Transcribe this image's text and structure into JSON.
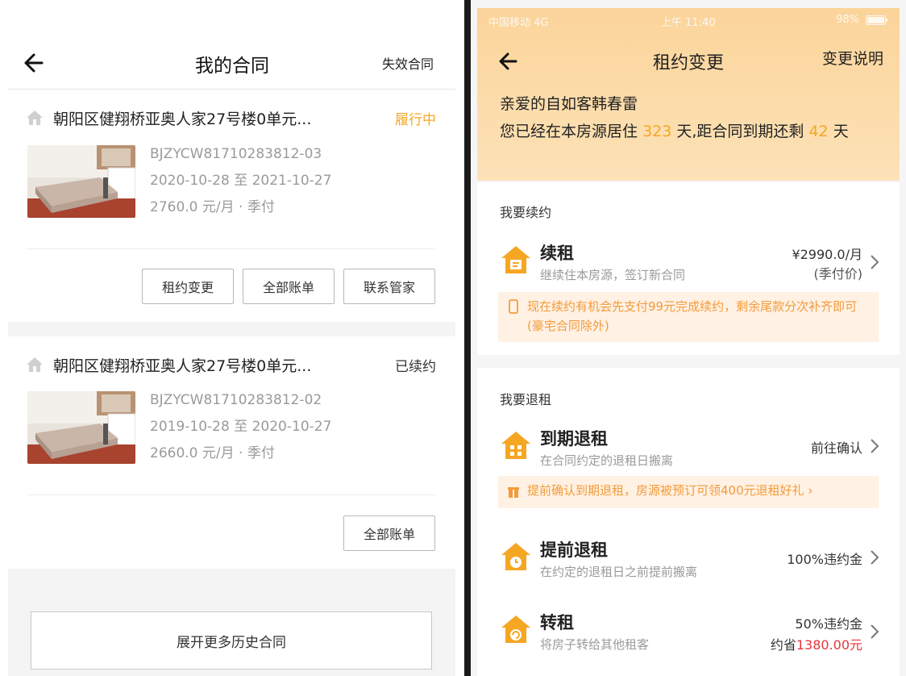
{
  "left": {
    "header": {
      "title": "我的合同",
      "right_link": "失效合同"
    },
    "contracts": [
      {
        "address": "朝阳区健翔桥亚奥人家27号楼0单元...",
        "status": "履行中",
        "status_color": "#f5a623",
        "code": "BJZYCW81710283812-03",
        "period": "2020-10-28 至 2021-10-27",
        "price": "2760.0 元/月 · 季付",
        "buttons": [
          "租约变更",
          "全部账单",
          "联系管家"
        ]
      },
      {
        "address": "朝阳区健翔桥亚奥人家27号楼0单元...",
        "status": "已续约",
        "status_color": "#333333",
        "code": "BJZYCW81710283812-02",
        "period": "2019-10-28 至 2020-10-27",
        "price": "2660.0 元/月 · 季付",
        "buttons": [
          "全部账单"
        ]
      }
    ],
    "expand_label": "展开更多历史合同"
  },
  "right": {
    "status_bar": {
      "carrier": "中国移动 4G",
      "time": "上午 11:40",
      "battery": "98%"
    },
    "header": {
      "title": "租约变更",
      "right_link": "变更说明"
    },
    "greeting": "亲爱的自如客韩春雷",
    "stay": {
      "prefix": "您已经在本房源居住",
      "days_lived": "323",
      "middle": "天,距合同到期还剩",
      "days_left": "42",
      "suffix": "天"
    },
    "renew_section": {
      "label": "我要续约",
      "option": {
        "title": "续租",
        "subtitle": "继续住本房源，签订新合同",
        "price": "¥2990.0/月",
        "price_note": "(季付价)"
      },
      "notice": "现在续约有机会先支付99元完成续约，剩余尾款分次补齐即可(豪宅合同除外)"
    },
    "terminate_section": {
      "label": "我要退租",
      "options": [
        {
          "title": "到期退租",
          "subtitle": "在合同约定的退租日搬离",
          "right": "前往确认"
        },
        {
          "title": "提前退租",
          "subtitle": "在约定的退租日之前提前搬离",
          "right": "100%违约金"
        },
        {
          "title": "转租",
          "subtitle": "将房子转给其他租客",
          "right": "50%违约金",
          "saving_prefix": "约省",
          "saving": "1380.00元"
        }
      ],
      "notice": "提前确认到期退租，房源被预订可领400元退租好礼 ›"
    },
    "accent_color": "#f5a623"
  }
}
